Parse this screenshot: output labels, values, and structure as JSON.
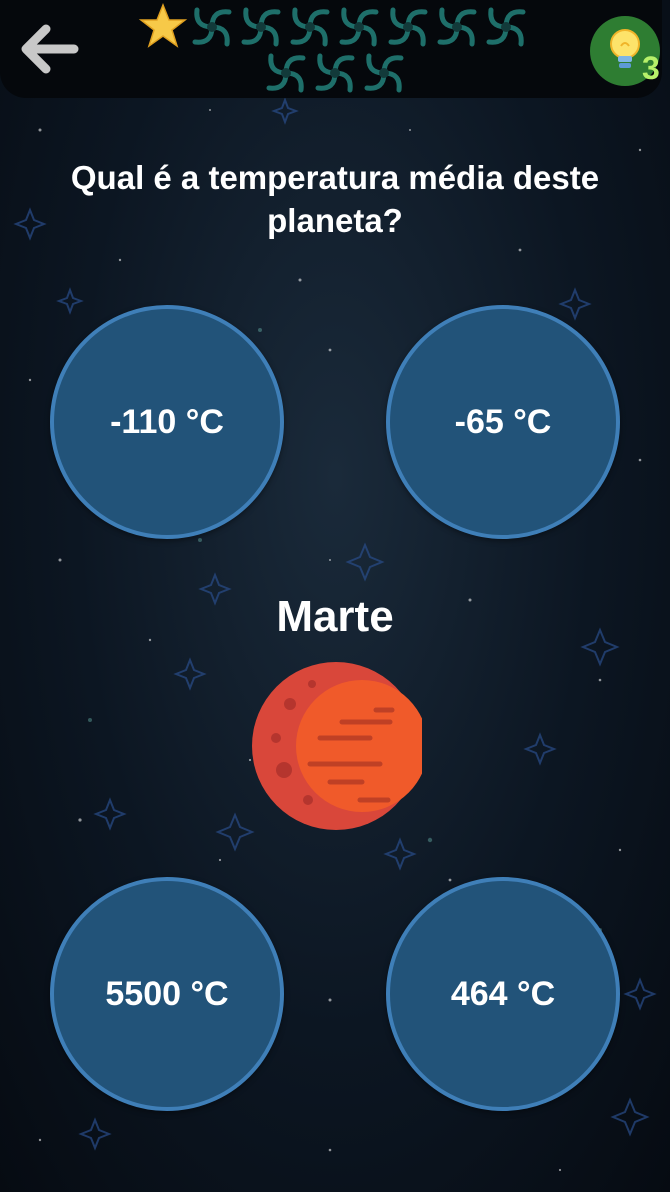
{
  "header": {
    "back_icon": "back-arrow-icon",
    "progress": {
      "completed": 1,
      "total": 11,
      "completed_icon": "star-icon",
      "pending_icon": "galaxy-icon"
    },
    "hint": {
      "icon": "lightbulb-icon",
      "count": "3"
    }
  },
  "question": "Qual é a temperatura média deste planeta?",
  "planet": {
    "name": "Marte",
    "icon": "mars-planet-icon"
  },
  "answers": [
    "-110 °C",
    "-65 °C",
    "5500 °C",
    "464 °C"
  ],
  "colors": {
    "answer_fill": "#225379",
    "answer_border": "#3f7fb8",
    "hint_bg": "#2e7d32",
    "hint_count": "#b7f06a",
    "star": "#f7c948",
    "galaxy": "#1e6f6a",
    "planet": "#e8553a"
  }
}
